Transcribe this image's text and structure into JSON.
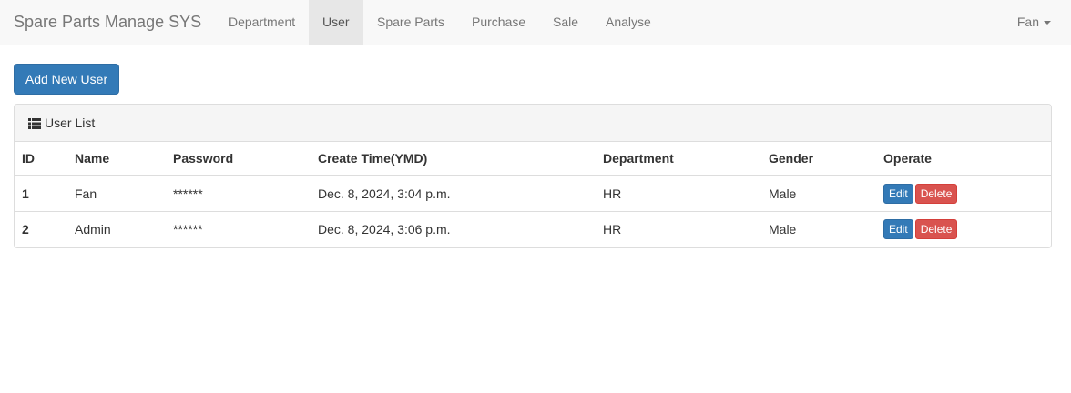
{
  "navbar": {
    "brand": "Spare Parts Manage SYS",
    "items": [
      {
        "label": "Department"
      },
      {
        "label": "User"
      },
      {
        "label": "Spare Parts"
      },
      {
        "label": "Purchase"
      },
      {
        "label": "Sale"
      },
      {
        "label": "Analyse"
      }
    ],
    "active": "User",
    "user": "Fan"
  },
  "toolbar": {
    "add_label": "Add New User"
  },
  "panel": {
    "title": "User List",
    "icon": "list-icon",
    "columns": [
      "ID",
      "Name",
      "Password",
      "Create Time(YMD)",
      "Department",
      "Gender",
      "Operate"
    ],
    "rows": [
      {
        "id": "1",
        "name": "Fan",
        "password": "******",
        "create_time": "Dec. 8, 2024, 3:04 p.m.",
        "department": "HR",
        "gender": "Male",
        "edit": "Edit",
        "delete": "Delete"
      },
      {
        "id": "2",
        "name": "Admin",
        "password": "******",
        "create_time": "Dec. 8, 2024, 3:06 p.m.",
        "department": "HR",
        "gender": "Male",
        "edit": "Edit",
        "delete": "Delete"
      }
    ]
  },
  "colors": {
    "primary": "#337ab7",
    "danger": "#d9534f",
    "navbar_bg": "#f8f8f8",
    "nav_active_bg": "#e7e7e7"
  }
}
